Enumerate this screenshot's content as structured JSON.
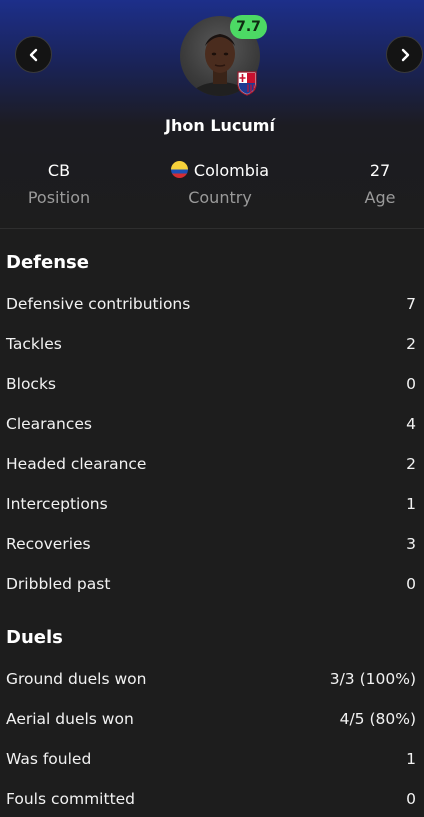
{
  "player": {
    "name": "Jhon Lucumí",
    "rating": "7.7"
  },
  "info": [
    {
      "value": "CB",
      "label": "Position"
    },
    {
      "value": "Colombia",
      "label": "Country"
    },
    {
      "value": "27",
      "label": "Age"
    }
  ],
  "defense": {
    "title": "Defense",
    "rows": [
      {
        "label": "Defensive contributions",
        "value": "7"
      },
      {
        "label": "Tackles",
        "value": "2"
      },
      {
        "label": "Blocks",
        "value": "0"
      },
      {
        "label": "Clearances",
        "value": "4"
      },
      {
        "label": "Headed clearance",
        "value": "2"
      },
      {
        "label": "Interceptions",
        "value": "1"
      },
      {
        "label": "Recoveries",
        "value": "3"
      },
      {
        "label": "Dribbled past",
        "value": "0"
      }
    ]
  },
  "duels": {
    "title": "Duels",
    "rows": [
      {
        "label": "Ground duels won",
        "value": "3/3 (100%)"
      },
      {
        "label": "Aerial duels won",
        "value": "4/5 (80%)"
      },
      {
        "label": "Was fouled",
        "value": "1"
      },
      {
        "label": "Fouls committed",
        "value": "0"
      }
    ]
  },
  "colors": {
    "rating_badge": "#4cd964",
    "header_gradient_top": "#1d2f8a",
    "background": "#1d1d1d"
  },
  "icons": {
    "prev": "chevron-left-icon",
    "next": "chevron-right-icon",
    "flag": "colombia-flag-icon",
    "club": "bologna-badge-icon"
  }
}
